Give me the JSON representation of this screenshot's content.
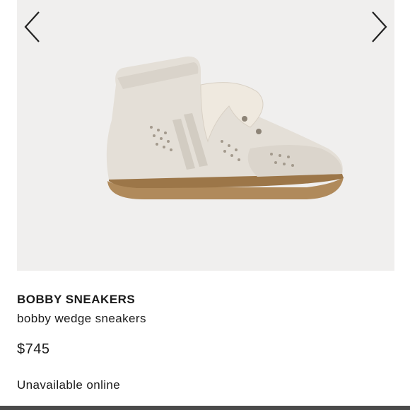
{
  "gallery": {
    "prev_icon": "chevron-left-icon",
    "next_icon": "chevron-right-icon",
    "image_subject": "white suede wedge sneaker"
  },
  "product": {
    "brand": "BOBBY SNEAKERS",
    "name": "bobby wedge sneakers",
    "price": "$745",
    "availability": "Unavailable online"
  },
  "colors": {
    "gallery_bg": "#f0efee",
    "text": "#1a1a1a",
    "bottom_bar": "#4a4a4a"
  }
}
